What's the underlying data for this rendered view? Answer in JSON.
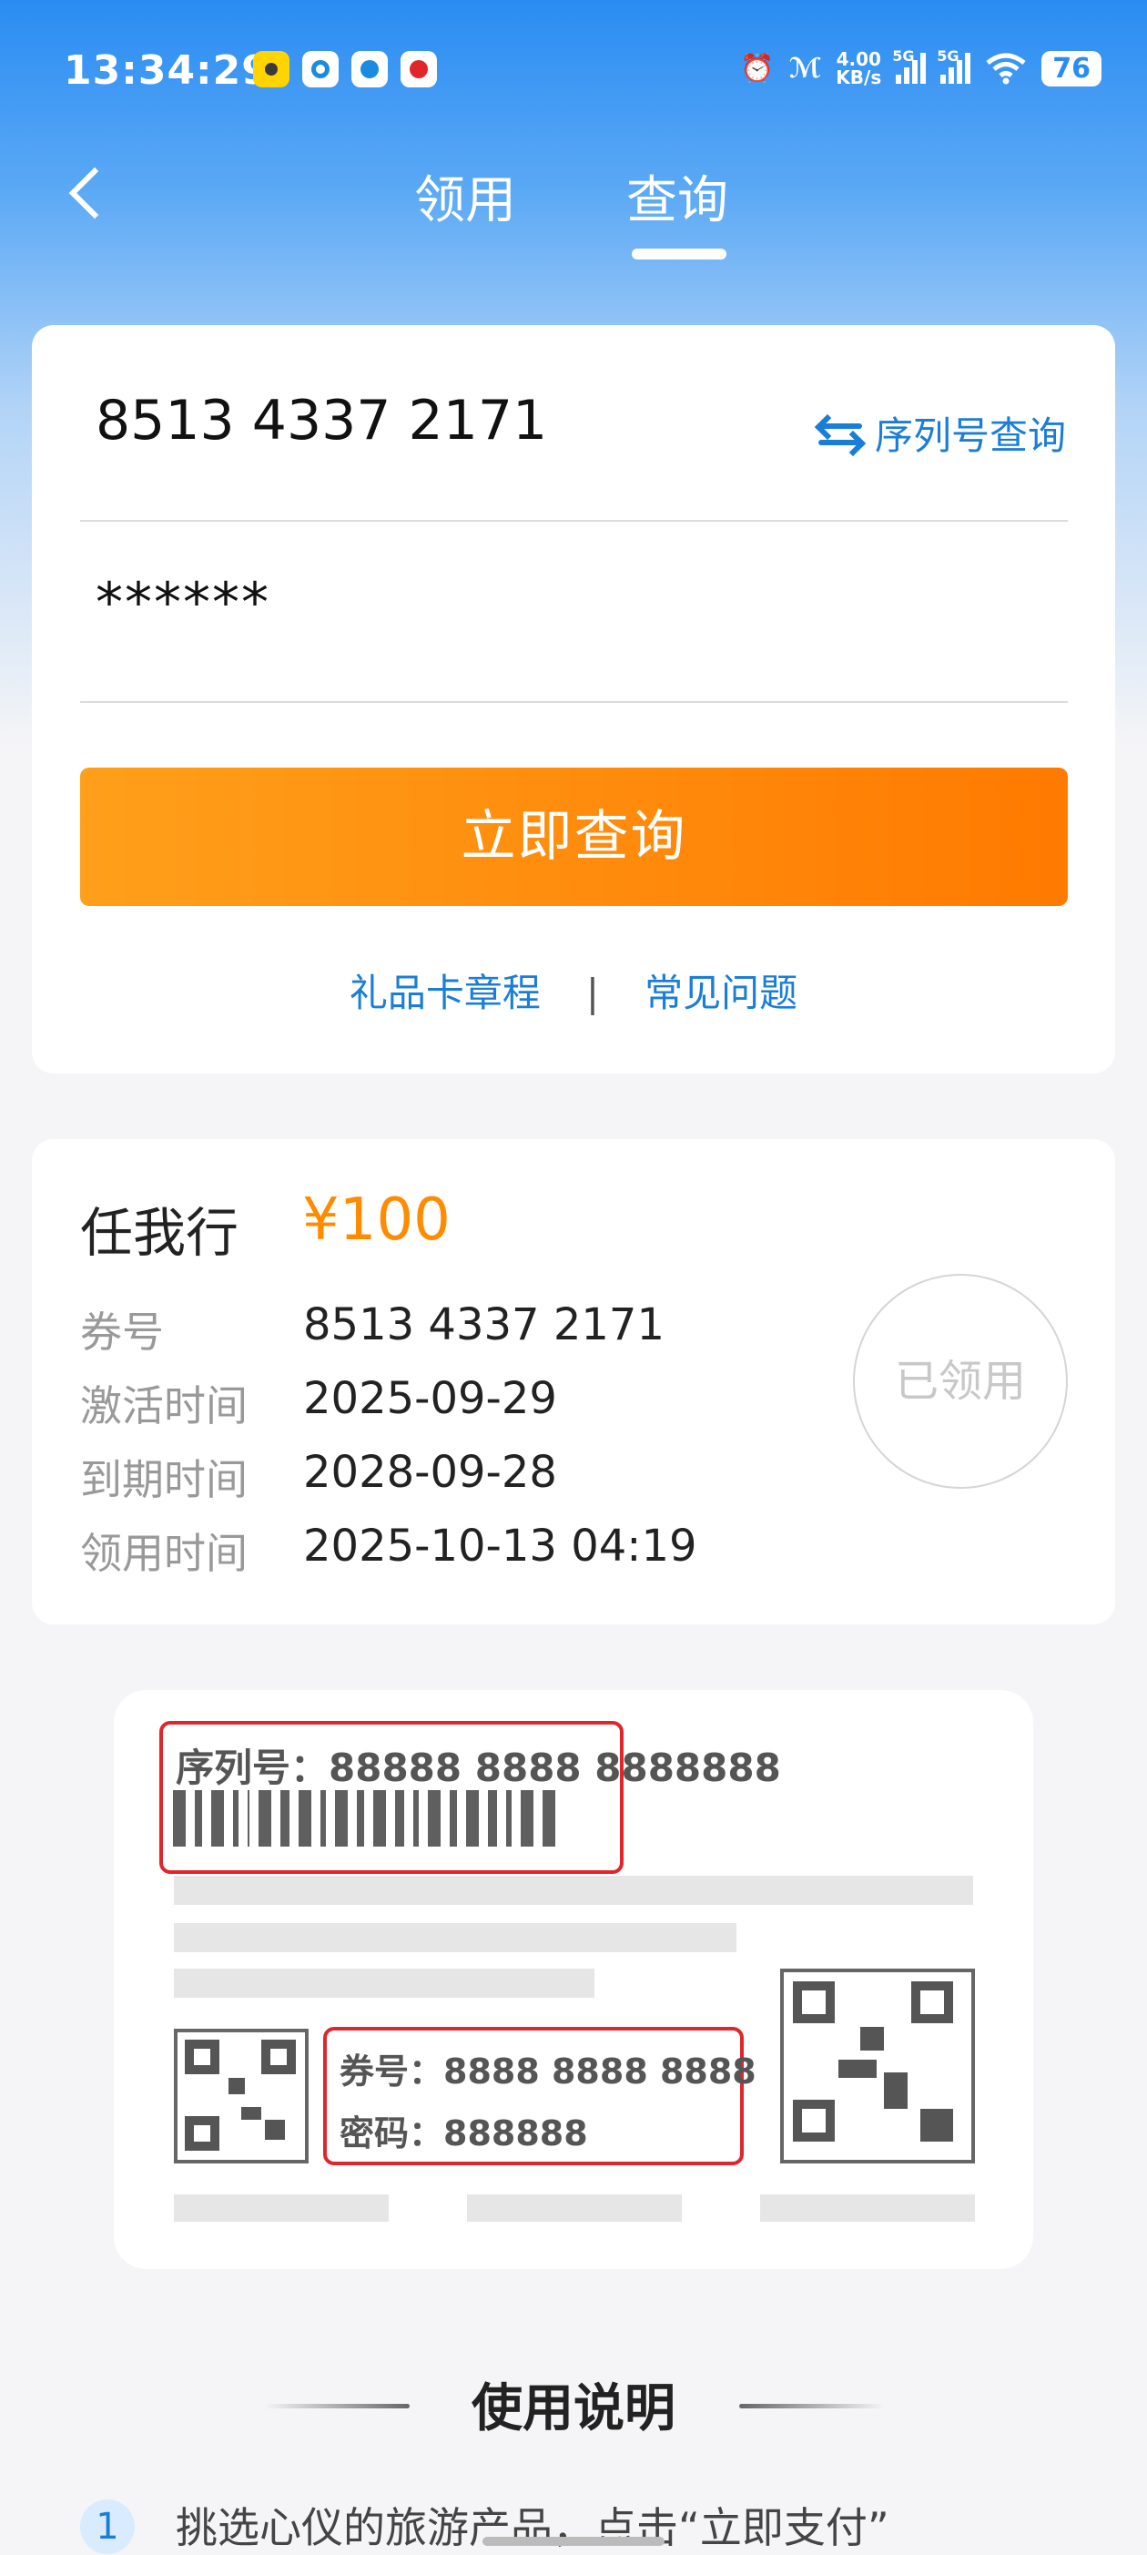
{
  "status_bar": {
    "time": "13:34:29",
    "net_speed_value": "4.00",
    "net_speed_unit": "KB/s",
    "signal_label_1": "5G",
    "signal_label_2": "5G",
    "battery": "76",
    "icons": [
      "app-yellow-icon",
      "app-blue-icon",
      "app-blue-circle-icon",
      "app-red-icon",
      "alarm-icon",
      "nfc-icon",
      "signal-icon",
      "signal-icon",
      "wifi-icon",
      "battery-icon"
    ]
  },
  "nav": {
    "tabs": [
      {
        "label": "领用",
        "active": false
      },
      {
        "label": "查询",
        "active": true
      }
    ]
  },
  "query_form": {
    "serial_value": "8513 4337 2171",
    "switch_label": "序列号查询",
    "password_value": "******",
    "submit_label": "立即查询",
    "links": [
      "礼品卡章程",
      "常见问题"
    ],
    "separator": "|"
  },
  "result": {
    "name": "任我行",
    "price": "¥100",
    "rows": [
      {
        "label": "券号",
        "value": "8513 4337 2171"
      },
      {
        "label": "激活时间",
        "value": "2025-09-29"
      },
      {
        "label": "到期时间",
        "value": "2028-09-28"
      },
      {
        "label": "领用时间",
        "value": "2025-10-13 04:19"
      }
    ],
    "stamp": "已领用"
  },
  "card_sample": {
    "serial_label": "序列号：88888 8888 8888888",
    "voucher_label": "券号：8888 8888 8888",
    "password_label": "密码：888888"
  },
  "instructions": {
    "title": "使用说明",
    "steps": [
      {
        "num": "1",
        "text": "挑选心仪的旅游产品，点击“立即支付”"
      }
    ]
  },
  "colors": {
    "accent_blue": "#1a7ed8",
    "header_blue": "#2a8cf2",
    "button_orange": "#ff8c00",
    "highlight_red": "#e0262b"
  }
}
